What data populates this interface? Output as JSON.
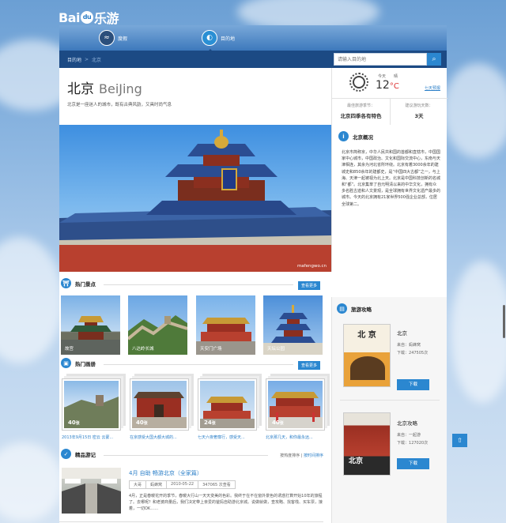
{
  "brand": {
    "part1": "Bai",
    "part2": "du",
    "part3": "乐游"
  },
  "nav": {
    "items": [
      {
        "label": "度假"
      },
      {
        "label": "目的地"
      }
    ]
  },
  "breadcrumb": {
    "root": "目的地",
    "separator": ">",
    "current": "北京"
  },
  "search": {
    "placeholder": "请输入目的地"
  },
  "city": {
    "name_cn": "北京",
    "name_en": "BeiJing",
    "description": "北京是一座迷人的城市，既有古典风韵，又具时尚气息"
  },
  "weather": {
    "day": "今天",
    "condition": "晴",
    "temp": "12",
    "unit": "°C",
    "forecast_link": "七天预报",
    "best_season_label": "最佳旅游季节：",
    "best_season_value": "北京四季各有特色",
    "suggested_days_label": "建议游玩天数：",
    "suggested_days_value": "3天"
  },
  "hero": {
    "watermark": "mafengwo.cn"
  },
  "overview": {
    "title": "北京概况",
    "text": "北京市简称京，中华人民共和国的首都和直辖市，中国国家中心城市，中国政治、文化和国际交流中心，东南与天津相连，其余为河北省所环绕。北京有着3000余年的建城史和850余年的建都史，是“中国四大古都”之一，与上海、天津一起被视为北上天。北京是中国科技创新的名城和“都”。北京集萃了自元明清以来的中华文化，拥有众多名胜古迹和人文景观，是全球拥有世界文化遗产最多的城市。今天的北京拥有21家世界500强企业总部，位居全球第二。"
  },
  "spots": {
    "title": "热门景点",
    "more": "查看更多",
    "items": [
      {
        "name": "故宫"
      },
      {
        "name": "八达岭长城"
      },
      {
        "name": "天安门广场"
      },
      {
        "name": "天坛公园"
      }
    ]
  },
  "albums": {
    "title": "热门画册",
    "more": "查看更多",
    "items": [
      {
        "count": "40",
        "unit": "张",
        "caption": "2013年9月15日 密云 云蒙..."
      },
      {
        "count": "40",
        "unit": "张",
        "caption": "在京感受大国大都大城的..."
      },
      {
        "count": "24",
        "unit": "张",
        "caption": "七天六夜奢靡行，感受天..."
      },
      {
        "count": "40",
        "unit": "张",
        "caption": "北京那几天，和你最永远..."
      }
    ]
  },
  "guides": {
    "title": "旅游攻略",
    "items": [
      {
        "title": "北京",
        "source_label": "来自：",
        "source": "蚂蜂窝",
        "downloads_label": "下载：",
        "downloads": "247505次",
        "button": "下载",
        "cover_text": "北 京"
      },
      {
        "title": "北京攻略",
        "source_label": "来自：",
        "source": "一起游",
        "downloads_label": "下载：",
        "downloads": "127020次",
        "button": "下载",
        "cover_text": "北京"
      }
    ]
  },
  "travelogue": {
    "title": "精品游记",
    "sort_hot": "按热度排序",
    "sort_sep": "|",
    "sort_time": "按时间排序",
    "item": {
      "title": "4月 自助 畅游北京（全家篇）",
      "tags": [
        "大哥",
        "蚂蜂窝",
        "2010-05-22",
        "347065 次查看"
      ],
      "excerpt": "4月，正是春暖花开的季节，春暖大行山一天天变美的色彩。我终于在不在窗外景色的诱惑打算开始10年的旅程了。去哪呢？和老婆商量后，我们决定带上亲爱的爸妈自助游北京城。说做就做，查攻略、找客栈、买车票，接着，一切OK……"
    }
  },
  "colors": {
    "accent": "#2b87d0",
    "navbar": "#1c4a84"
  }
}
